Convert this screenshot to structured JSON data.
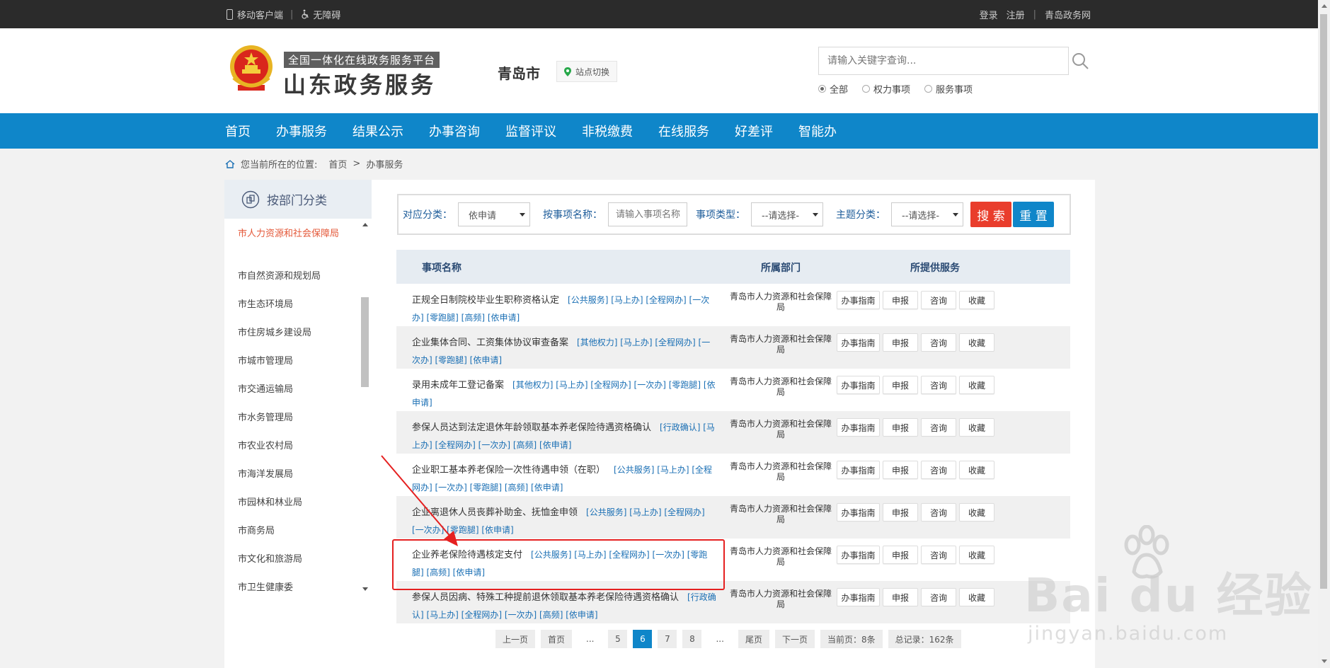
{
  "topbar": {
    "mobile": "移动客户端",
    "accessible": "无障碍",
    "login": "登录",
    "register": "注册",
    "city_site": "青岛政务网"
  },
  "header": {
    "slogan": "全国一体化在线政务服务平台",
    "brand": "山东政务服务",
    "city": "青岛市",
    "switch_label": "站点切换",
    "search_placeholder": "请输入关键字查询...",
    "radios": [
      "全部",
      "权力事项",
      "服务事项"
    ],
    "radio_selected": "全部"
  },
  "nav": [
    "首页",
    "办事服务",
    "结果公示",
    "办事咨询",
    "监督评议",
    "非税缴费",
    "在线服务",
    "好差评",
    "智能办"
  ],
  "breadcrumb": {
    "prefix": "您当前所在的位置:",
    "items": [
      "首页",
      "办事服务"
    ],
    "separator": ">"
  },
  "sidebar": {
    "title": "按部门分类",
    "items": [
      "市人力资源和社会保障局",
      "市自然资源和规划局",
      "市生态环境局",
      "市住房城乡建设局",
      "市城市管理局",
      "市交通运输局",
      "市水务管理局",
      "市农业农村局",
      "市海洋发展局",
      "市园林和林业局",
      "市商务局",
      "市文化和旅游局",
      "市卫生健康委"
    ],
    "active_index": 0
  },
  "filter": {
    "category_label": "对应分类：",
    "category_value": "依申请",
    "name_label": "按事项名称：",
    "name_placeholder": "请输入事项名称",
    "type_label": "事项类型：",
    "type_value": "--请选择-",
    "theme_label": "主题分类：",
    "theme_value": "--请选择-",
    "search_btn": "搜 索",
    "reset_btn": "重 置"
  },
  "table": {
    "headers": [
      "事项名称",
      "所属部门",
      "所提供服务"
    ],
    "op_labels": [
      "办事指南",
      "申报",
      "咨询",
      "收藏"
    ],
    "rows": [
      {
        "name": "正规全日制院校毕业生职称资格认定",
        "tags": "[公共服务] [马上办] [全程网办] [一次办] [零跑腿] [高频] [依申请]",
        "dept": "青岛市人力资源和社会保障局"
      },
      {
        "name": "企业集体合同、工资集体协议审查备案",
        "tags": "[其他权力] [马上办] [全程网办] [一次办] [零跑腿] [依申请]",
        "dept": "青岛市人力资源和社会保障局"
      },
      {
        "name": "录用未成年工登记备案",
        "tags": "[其他权力] [马上办] [全程网办] [一次办] [零跑腿] [依申请]",
        "dept": "青岛市人力资源和社会保障局"
      },
      {
        "name": "参保人员达到法定退休年龄领取基本养老保险待遇资格确认",
        "tags": "[行政确认] [马上办] [全程网办] [一次办] [高频] [依申请]",
        "dept": "青岛市人力资源和社会保障局"
      },
      {
        "name": "企业职工基本养老保险一次性待遇申领（在职）",
        "tags": "[公共服务] [马上办] [全程网办] [一次办] [零跑腿] [高频] [依申请]",
        "dept": "青岛市人力资源和社会保障局"
      },
      {
        "name": "企业离退休人员丧葬补助金、抚恤金申领",
        "tags": "[公共服务] [马上办] [全程网办] [一次办] [零跑腿] [依申请]",
        "dept": "青岛市人力资源和社会保障局"
      },
      {
        "name": "企业养老保险待遇核定支付",
        "tags": "[公共服务] [马上办] [全程网办] [一次办] [零跑腿] [高频] [依申请]",
        "dept": "青岛市人力资源和社会保障局"
      },
      {
        "name": "参保人员因病、特殊工种提前退休领取基本养老保险待遇资格确认",
        "tags": "[行政确认] [马上办] [全程网办] [一次办] [高频] [依申请]",
        "dept": "青岛市人力资源和社会保障局"
      }
    ]
  },
  "pager": {
    "prev": "上一页",
    "first": "首页",
    "ellipsis": "...",
    "pages": [
      "5",
      "6",
      "7",
      "8"
    ],
    "current": "6",
    "last": "尾页",
    "next": "下一页",
    "per_page": "当前页：8条",
    "total": "总记录：162条"
  },
  "watermark": {
    "text": "Bai du 经验",
    "url": "jingyan.baidu.com"
  },
  "colors": {
    "nav_blue": "#0f86c9",
    "search_red": "#e93d2c",
    "active_orange": "#e4593a",
    "tag_blue": "#1a6fb4",
    "annotation_red": "#e52020"
  }
}
